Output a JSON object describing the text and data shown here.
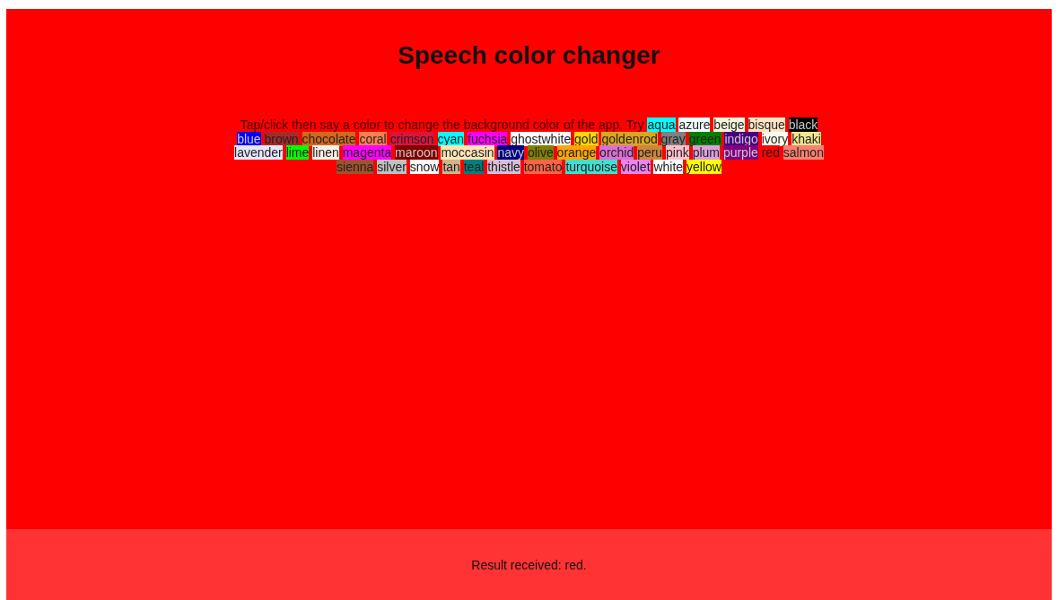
{
  "title": "Speech color changer",
  "hint": "Tap/click then say a color to change the background color of the app. Try",
  "colors": [
    {
      "name": "aqua",
      "color": "#00ffff"
    },
    {
      "name": "azure",
      "color": "#f0ffff"
    },
    {
      "name": "beige",
      "color": "#f5f5dc"
    },
    {
      "name": "bisque",
      "color": "#ffe4c4"
    },
    {
      "name": "black",
      "color": "#000000"
    },
    {
      "name": "blue",
      "color": "#0000ff"
    },
    {
      "name": "brown",
      "color": "#a52a2a"
    },
    {
      "name": "chocolate",
      "color": "#d2691e"
    },
    {
      "name": "coral",
      "color": "#ff7f50"
    },
    {
      "name": "crimson",
      "color": "#dc143c"
    },
    {
      "name": "cyan",
      "color": "#00ffff"
    },
    {
      "name": "fuchsia",
      "color": "#ff00ff"
    },
    {
      "name": "ghostwhite",
      "color": "#f8f8ff"
    },
    {
      "name": "gold",
      "color": "#ffd700"
    },
    {
      "name": "goldenrod",
      "color": "#daa520"
    },
    {
      "name": "gray",
      "color": "#808080"
    },
    {
      "name": "green",
      "color": "#008000"
    },
    {
      "name": "indigo",
      "color": "#4b0082"
    },
    {
      "name": "ivory",
      "color": "#fffff0"
    },
    {
      "name": "khaki",
      "color": "#f0e68c"
    },
    {
      "name": "lavender",
      "color": "#e6e6fa"
    },
    {
      "name": "lime",
      "color": "#00ff00"
    },
    {
      "name": "linen",
      "color": "#faf0e6"
    },
    {
      "name": "magenta",
      "color": "#ff00ff"
    },
    {
      "name": "maroon",
      "color": "#800000"
    },
    {
      "name": "moccasin",
      "color": "#ffe4b5"
    },
    {
      "name": "navy",
      "color": "#000080"
    },
    {
      "name": "olive",
      "color": "#808000"
    },
    {
      "name": "orange",
      "color": "#ffa500"
    },
    {
      "name": "orchid",
      "color": "#da70d6"
    },
    {
      "name": "peru",
      "color": "#cd853f"
    },
    {
      "name": "pink",
      "color": "#ffc0cb"
    },
    {
      "name": "plum",
      "color": "#dda0dd"
    },
    {
      "name": "purple",
      "color": "#800080"
    },
    {
      "name": "red",
      "color": "#ff0000"
    },
    {
      "name": "salmon",
      "color": "#fa8072"
    },
    {
      "name": "sienna",
      "color": "#a0522d"
    },
    {
      "name": "silver",
      "color": "#c0c0c0"
    },
    {
      "name": "snow",
      "color": "#fffafa"
    },
    {
      "name": "tan",
      "color": "#d2b48c"
    },
    {
      "name": "teal",
      "color": "#008080"
    },
    {
      "name": "thistle",
      "color": "#d8bfd8"
    },
    {
      "name": "tomato",
      "color": "#ff6347"
    },
    {
      "name": "turquoise",
      "color": "#40e0d0"
    },
    {
      "name": "violet",
      "color": "#ee82ee"
    },
    {
      "name": "white",
      "color": "#ffffff"
    },
    {
      "name": "yellow",
      "color": "#ffff00"
    }
  ],
  "result": "Result received: red."
}
